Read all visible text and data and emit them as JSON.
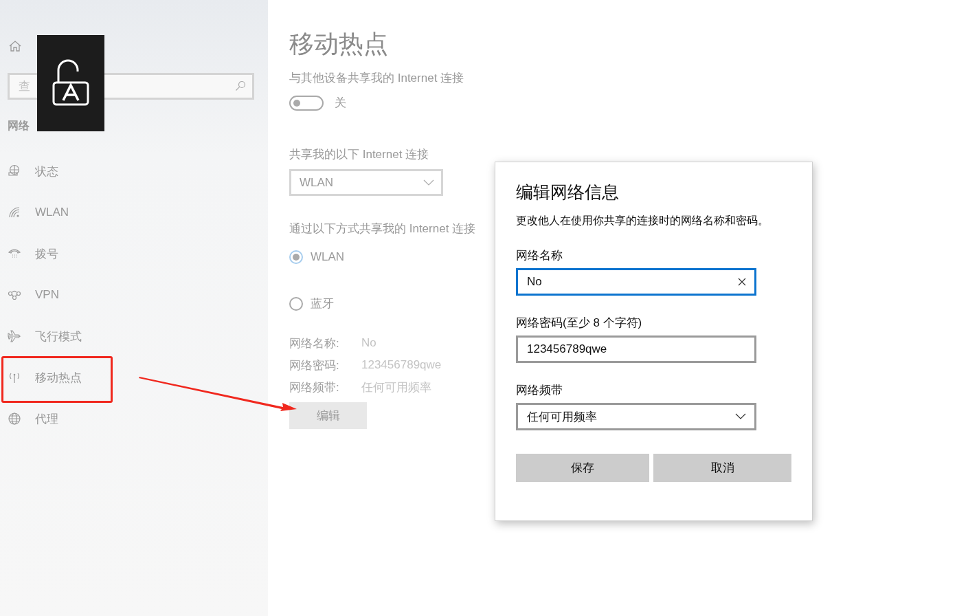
{
  "sidebar": {
    "search": {
      "placeholder": "查"
    },
    "section": "网络",
    "items": [
      {
        "kind": "status",
        "label": "状态"
      },
      {
        "kind": "wifi",
        "label": "WLAN"
      },
      {
        "kind": "dialup",
        "label": "拨号"
      },
      {
        "kind": "vpn",
        "label": "VPN"
      },
      {
        "kind": "airplane",
        "label": "飞行模式"
      },
      {
        "kind": "hotspot",
        "label": "移动热点"
      },
      {
        "kind": "proxy",
        "label": "代理"
      }
    ]
  },
  "main": {
    "title": "移动热点",
    "share_label": "与其他设备共享我的 Internet 连接",
    "toggle": {
      "on": false,
      "label": "关"
    },
    "source_label": "共享我的以下 Internet 连接",
    "source": "WLAN",
    "via_label": "通过以下方式共享我的 Internet 连接",
    "via_options": [
      {
        "label": "WLAN",
        "selected": true
      },
      {
        "label": "蓝牙",
        "selected": false
      }
    ],
    "properties": [
      {
        "name": "网络名称:",
        "value": "No"
      },
      {
        "name": "网络密码:",
        "value": "123456789qwe"
      },
      {
        "name": "网络频带:",
        "value": "任何可用频率"
      }
    ],
    "edit_button": "编辑"
  },
  "dialog": {
    "title": "编辑网络信息",
    "description": "更改他人在使用你共享的连接时的网络名称和密码。",
    "fields": [
      {
        "kind": "text",
        "label": "网络名称",
        "value": "No",
        "focused": true
      },
      {
        "kind": "text",
        "label": "网络密码(至少 8 个字符)",
        "value": "123456789qwe",
        "focused": false
      },
      {
        "kind": "select",
        "label": "网络频带",
        "value": "任何可用频率",
        "focused": false
      }
    ],
    "buttons": [
      "保存",
      "取消"
    ]
  }
}
